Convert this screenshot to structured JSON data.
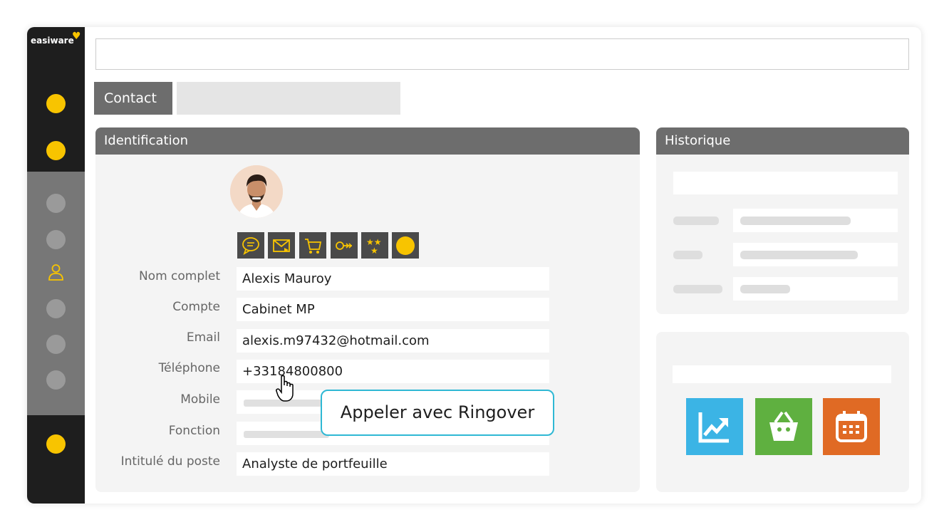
{
  "app": {
    "logo": "easiware",
    "accent_color": "#f8c400"
  },
  "sidebar": {
    "icons": [
      "dot",
      "dot",
      "dot",
      "dot",
      "user-icon",
      "dot",
      "dot",
      "dot",
      "dot"
    ],
    "active": "user-icon"
  },
  "tabs": {
    "contact_label": "Contact"
  },
  "identification": {
    "title": "Identification",
    "action_icons": [
      "chat-icon",
      "mail-icon",
      "cart-icon",
      "key-icon",
      "stars-icon",
      "circle-icon"
    ],
    "fields": [
      {
        "label": "Nom complet",
        "value": "Alexis Mauroy"
      },
      {
        "label": "Compte",
        "value": "Cabinet MP"
      },
      {
        "label": "Email",
        "value": "alexis.m97432@hotmail.com"
      },
      {
        "label": "Téléphone",
        "value": "+33184800800"
      },
      {
        "label": "Mobile",
        "value": ""
      },
      {
        "label": "Fonction",
        "value": ""
      },
      {
        "label": "Intitulé du poste",
        "value": "Analyste de portfeuille"
      }
    ]
  },
  "tooltip": {
    "text": "Appeler avec Ringover",
    "border_color": "#2fb8d4"
  },
  "historique": {
    "title": "Historique"
  },
  "quick_actions": {
    "buttons": [
      {
        "icon": "chart-icon",
        "color": "#3bb4e5"
      },
      {
        "icon": "basket-icon",
        "color": "#5fb040"
      },
      {
        "icon": "calendar-icon",
        "color": "#e06a24"
      }
    ]
  }
}
